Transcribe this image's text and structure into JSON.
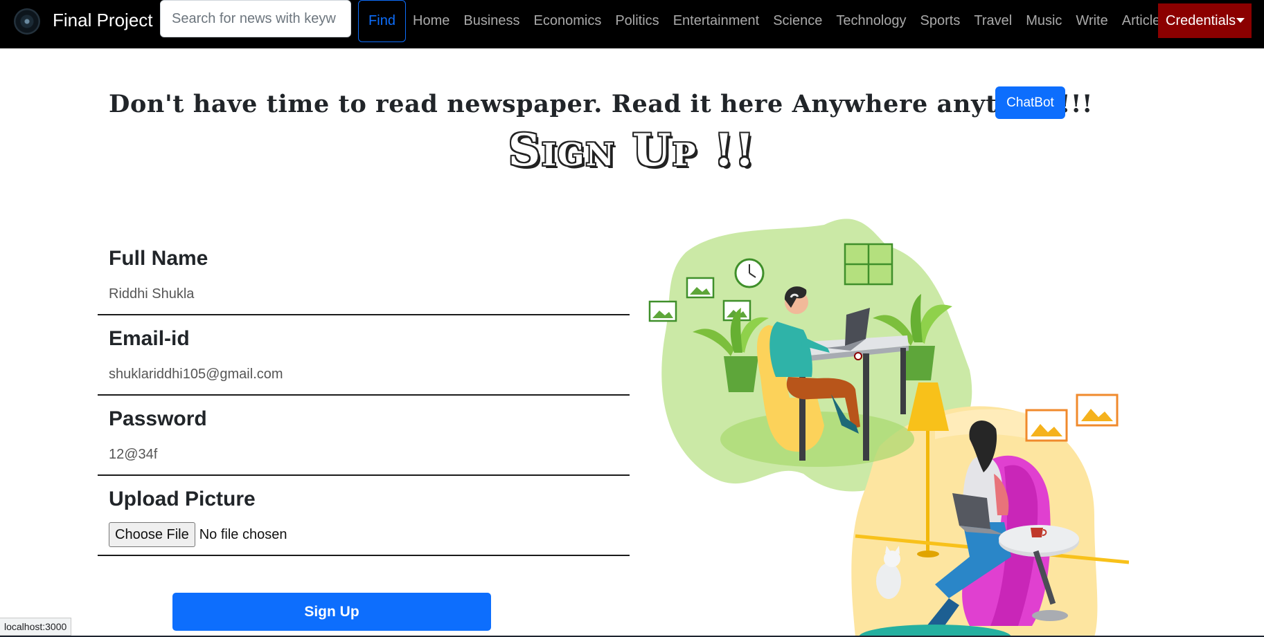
{
  "navbar": {
    "brand": "Final Project",
    "search_placeholder": "Search for news with keyw",
    "find_label": "Find",
    "links": [
      "Home",
      "Business",
      "Economics",
      "Politics",
      "Entertainment",
      "Science",
      "Technology",
      "Sports",
      "Travel",
      "Music",
      "Write",
      "Articles"
    ],
    "credentials_label": "Credentials"
  },
  "header": {
    "tagline": "Don't have time to read newspaper. Read it here Anywhere anytime!!!!",
    "chatbot_label": "ChatBot",
    "title": "Sign Up !!"
  },
  "form": {
    "fields": [
      {
        "label": "Full Name",
        "value": "Riddhi Shukla"
      },
      {
        "label": "Email-id",
        "value": "shuklariddhi105@gmail.com"
      },
      {
        "label": "Password",
        "value": "12@34f"
      }
    ],
    "upload": {
      "label": "Upload Picture",
      "button": "Choose File",
      "status": "No file chosen"
    },
    "submit_label": "Sign Up"
  },
  "status_bar": "localhost:3000",
  "colors": {
    "primary": "#0d6efd",
    "credentials": "#8b0000",
    "navbar": "#000000"
  }
}
